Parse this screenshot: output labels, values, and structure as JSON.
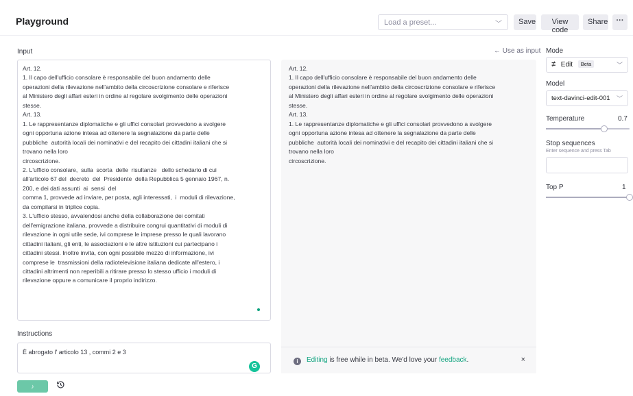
{
  "header": {
    "title": "Playground",
    "preset_placeholder": "Load a preset...",
    "save_label": "Save",
    "view_code_label": "View code",
    "share_label": "Share",
    "more_label": "···"
  },
  "input": {
    "label": "Input",
    "use_as_input": "← Use as input",
    "text": "Art. 12.\n1. Il capo dell'ufficio consolare è responsabile del buon andamento delle\noperazioni della rilevazione nell'ambito della circoscrizione consolare e riferisce\nal Ministero degli affari esteri in ordine al regolare svolgimento delle operazioni\nstesse.\nArt. 13.\n1. Le rappresentanze diplomatiche e gli uffici consolari provvedono a svolgere\nogni opportuna azione intesa ad ottenere la segnalazione da parte delle\npubbliche  autorità locali dei nominativi e del recapito dei cittadini italiani che si\ntrovano nella loro\ncircoscrizione.\n2. L'ufficio consolare,  sulla  scorta  delle  risultanze   dello schedario di cui\nall'articolo 67 del  decreto  del  Presidente  della Repubblica 5 gennaio 1967, n.\n200, e dei dati assunti  ai  sensi  del\ncomma 1, provvede ad inviare, per posta, agli interessati,  i  moduli di rilevazione,\nda compilarsi in triplice copia.\n3. L'ufficio stesso, avvalendosi anche della collaborazione dei comitati\ndell'emigrazione italiana, provvede a distribuire congrui quantitativi di moduli di\nrilevazione in ogni utile sede, ivi comprese le imprese presso le quali lavorano\ncittadini italiani, gli enti, le associazioni e le altre istituzioni cui partecipano i\ncittadini stessi. Inoltre invita, con ogni possibile mezzo di informazione, ivi\ncomprese le  trasmissioni della radiotelevisione italiana dedicate all'estero, i\ncittadini altrimenti non reperibili a ritirare presso lo stesso ufficio i moduli di\nrilevazione oppure a comunicare il proprio indirizzo."
  },
  "output": {
    "text": "Art. 12.\n1. Il capo dell'ufficio consolare è responsabile del buon andamento delle\noperazioni della rilevazione nell'ambito della circoscrizione consolare e riferisce\nal Ministero degli affari esteri in ordine al regolare svolgimento delle operazioni\nstesse.\nArt. 13.\n1. Le rappresentanze diplomatiche e gli uffici consolari provvedono a svolgere\nogni opportuna azione intesa ad ottenere la segnalazione da parte delle\npubbliche  autorità locali dei nominativi e del recapito dei cittadini italiani che si\ntrovano nella loro\ncircoscrizione."
  },
  "notice": {
    "link1": "Editing",
    "text": " is free while in beta. We'd love your ",
    "link2": "feedback",
    "end": ".",
    "close": "×"
  },
  "instructions": {
    "label": "Instructions",
    "value": "È abrogato l' articolo 13 , commi 2 e 3",
    "grammarly": "G"
  },
  "actions": {
    "submit_label": "♪"
  },
  "sidebar": {
    "mode_label": "Mode",
    "mode_value": "Edit",
    "mode_badge": "Beta",
    "model_label": "Model",
    "model_value": "text-davinci-edit-001",
    "temperature_label": "Temperature",
    "temperature_value": "0.7",
    "temperature": 0.7,
    "stop_label": "Stop sequences",
    "stop_help": "Enter sequence and press Tab",
    "top_p_label": "Top P",
    "top_p_value": "1",
    "top_p": 1
  },
  "colors": {
    "accent": "#10a37f",
    "submit": "#6cc8a8"
  }
}
